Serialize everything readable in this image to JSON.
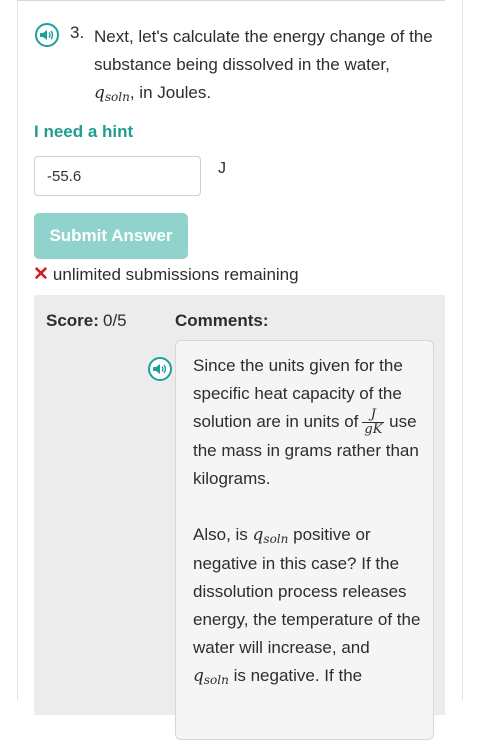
{
  "question": {
    "number": "3.",
    "text_part1": "Next, let's calculate the energy change of the substance being dissolved in the water,",
    "symbol_q": "q",
    "symbol_sub": "soln",
    "text_part2": ", in Joules."
  },
  "hint_link": "I need a hint",
  "answer": {
    "value": "-55.6",
    "unit": "J"
  },
  "submit_label": "Submit Answer",
  "remaining_text": "unlimited submissions remaining",
  "feedback": {
    "score_label": "Score:",
    "score_value": "0/5",
    "comments_label": "Comments:",
    "comment_p1_a": "Since the units given for the specific heat capacity of the solution are in units of",
    "frac_num": "J",
    "frac_den": "gK",
    "comment_p1_b": "use the mass in grams rather than kilograms.",
    "comment_p2_a": "Also, is",
    "symbol_q": "q",
    "symbol_sub": "soln",
    "comment_p2_b": "positive or negative in this case? If the dissolution process releases energy, the temperature of the water will increase, and",
    "comment_p2_c": "is negative. If the"
  },
  "colors": {
    "accent": "#1aa19f",
    "hint": "#1e9e8f",
    "button": "#8fd3cc",
    "error_x": "#d11f1f",
    "feedback_bg": "#ececec"
  },
  "icons": {
    "speaker": "speaker-icon",
    "error": "x-icon"
  }
}
